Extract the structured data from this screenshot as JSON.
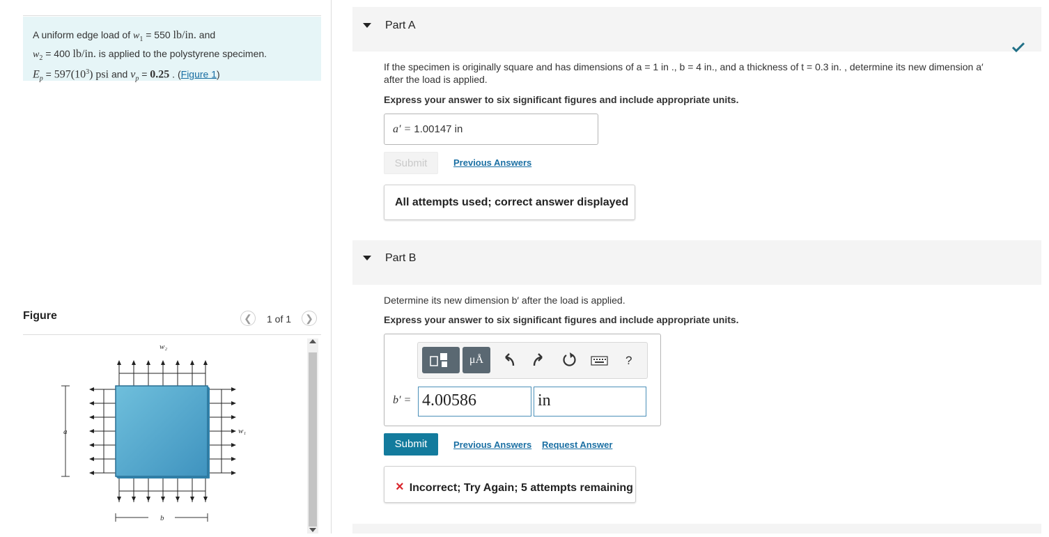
{
  "problem": {
    "sentence1_prefix": "A uniform edge load of ",
    "w1_symbol": "w",
    "w1_sub": "1",
    "w1_eq": " = 550 ",
    "w1_unit": "lb/in.",
    "and1": " and",
    "w2_symbol": "w",
    "w2_sub": "2",
    "w2_eq": " = 400 ",
    "w2_unit": "lb/in.",
    "sentence1_suffix": " is applied to the polystyrene specimen.",
    "Ep_symbol": "E",
    "Ep_sub": "p",
    "Ep_eq": " = ",
    "Ep_value": "597(10",
    "Ep_exp": "3",
    "Ep_close": ")",
    "Ep_unit": " psi",
    "and2": " and ",
    "nu_symbol": "ν",
    "nu_sub": "p",
    "nu_eq": " = ",
    "nu_value": "0.25",
    "figure_ref_pre": " . (",
    "figure_link": "Figure 1",
    "figure_ref_post": ")"
  },
  "figure_panel": {
    "title": "Figure",
    "pager_text": "1 of 1",
    "prev_icon": "chevron-left-icon",
    "next_icon": "chevron-right-icon",
    "labels": {
      "w2": "w₂",
      "w1": "w₁",
      "a": "a",
      "b": "b"
    },
    "colors": {
      "specimen": "#5aaed0",
      "specimen_dark": "#2f7fa8"
    }
  },
  "part_a": {
    "title": "Part A",
    "question_pre": "If the specimen is originally square and has dimensions of ",
    "question_dims": "a = 1 in ., b = 4 in., and a thickness of t = 0.3 in. , determine its new dimension a′",
    "question_line2": "after the load is applied.",
    "instructions": "Express your answer to six significant figures and include appropriate units.",
    "answer_label": "a′ = ",
    "answer_value": "1.00147 in",
    "submit_label": "Submit",
    "previous_answers": "Previous Answers",
    "feedback": "All attempts used; correct answer displayed",
    "status_icon": "checkmark-icon"
  },
  "part_b": {
    "title": "Part B",
    "question": "Determine its new dimension b′ after the load is applied.",
    "instructions": "Express your answer to six significant figures and include appropriate units.",
    "toolbar": {
      "units_label": "μÅ",
      "help_label": "?",
      "icons": [
        "templates-icon",
        "units-icon",
        "undo-icon",
        "redo-icon",
        "reset-icon",
        "keyboard-icon",
        "help-icon"
      ]
    },
    "answer_label": "b′ = ",
    "answer_value": "4.00586",
    "unit_value": "in",
    "submit_label": "Submit",
    "previous_answers": "Previous Answers",
    "request_answer": "Request Answer",
    "feedback_icon": "×",
    "feedback": "Incorrect; Try Again; 5 attempts remaining"
  },
  "colors": {
    "accent": "#137b9d",
    "link": "#1a6fa3",
    "problem_bg": "#e6f5f7",
    "incorrect": "#d9262d",
    "correct": "#1f6f86"
  }
}
